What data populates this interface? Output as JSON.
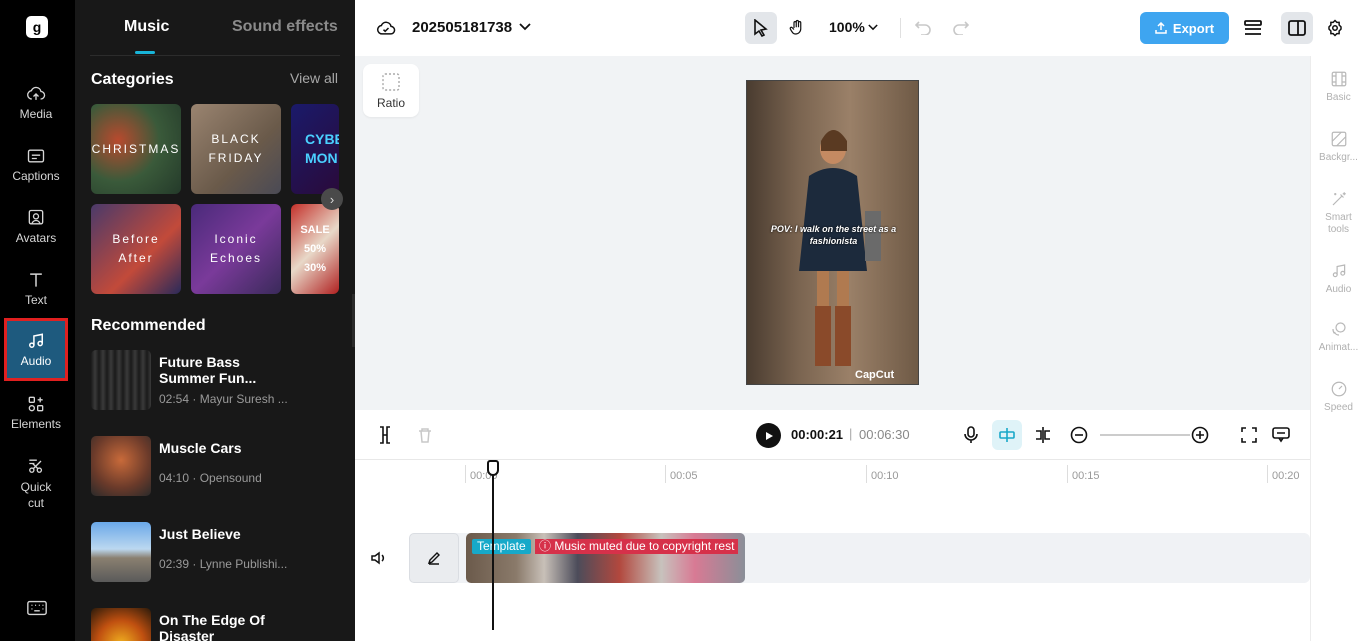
{
  "rail": {
    "logo_glyph": "g",
    "items": [
      {
        "label": "Media",
        "icon": "cloud-upload-icon"
      },
      {
        "label": "Captions",
        "icon": "captions-icon"
      },
      {
        "label": "Avatars",
        "icon": "avatar-icon"
      },
      {
        "label": "Text",
        "icon": "text-icon"
      },
      {
        "label": "Audio",
        "icon": "music-note-icon",
        "active": true
      },
      {
        "label": "Elements",
        "icon": "elements-icon"
      },
      {
        "label": "Quick cut",
        "icon": "scissors-icon"
      }
    ]
  },
  "panel": {
    "tabs": [
      {
        "label": "Music",
        "active": true
      },
      {
        "label": "Sound effects"
      }
    ],
    "categories_title": "Categories",
    "view_all": "View all",
    "categories": [
      {
        "label": "CHRISTMAS"
      },
      {
        "label": "BLACK FRIDAY"
      },
      {
        "label": "CYBER MON"
      },
      {
        "label": "Before After"
      },
      {
        "label": "Iconic Echoes"
      },
      {
        "label": "SALE 50% 30%"
      }
    ],
    "recommended_title": "Recommended",
    "tracks": [
      {
        "name": "Future Bass Summer Fun...",
        "meta": "02:54 · Mayur Suresh ..."
      },
      {
        "name": "Muscle Cars",
        "meta": "04:10 · Opensound"
      },
      {
        "name": "Just Believe",
        "meta": "02:39 · Lynne Publishi..."
      },
      {
        "name": "On The Edge Of Disaster",
        "meta": ""
      }
    ]
  },
  "topbar": {
    "project_name": "202505181738",
    "zoom": "100%",
    "export_label": "Export"
  },
  "canvas": {
    "ratio_label": "Ratio",
    "caption": "POV: I walk on the street as a fashionista",
    "watermark": "CapCut"
  },
  "right_panel": {
    "items": [
      {
        "label": "Basic"
      },
      {
        "label": "Backgr..."
      },
      {
        "label": "Smart tools"
      },
      {
        "label": "Audio"
      },
      {
        "label": "Animat..."
      },
      {
        "label": "Speed"
      }
    ]
  },
  "playback": {
    "current_time": "00:00:21",
    "separator": "|",
    "total_time": "00:06:30"
  },
  "timeline": {
    "ruler_labels": [
      "00:00",
      "00:05",
      "00:10",
      "00:15",
      "00:20"
    ],
    "clip_tag": "Template",
    "clip_warning": "Music muted due to copyright rest"
  },
  "colors": {
    "accent": "#18b4d8",
    "export": "#3ea5f0",
    "warning": "#d6314a",
    "active_rail": "#1e5a7e"
  }
}
